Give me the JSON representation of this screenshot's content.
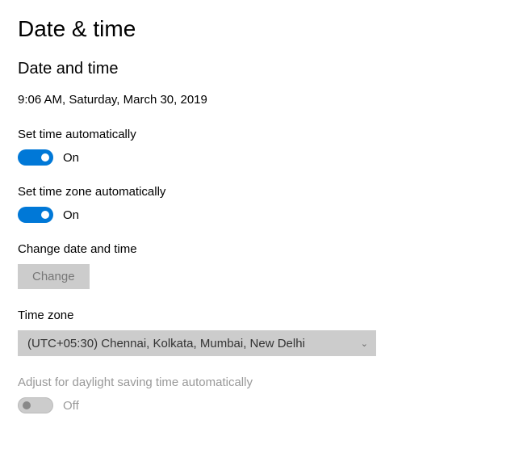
{
  "header": {
    "page_title": "Date & time"
  },
  "section": {
    "title": "Date and time",
    "current_datetime": "9:06 AM, Saturday, March 30, 2019"
  },
  "set_time_auto": {
    "label": "Set time automatically",
    "state": "On"
  },
  "set_tz_auto": {
    "label": "Set time zone automatically",
    "state": "On"
  },
  "change_dt": {
    "label": "Change date and time",
    "button": "Change"
  },
  "timezone": {
    "label": "Time zone",
    "selected": "(UTC+05:30) Chennai, Kolkata, Mumbai, New Delhi"
  },
  "dst": {
    "label": "Adjust for daylight saving time automatically",
    "state": "Off"
  }
}
